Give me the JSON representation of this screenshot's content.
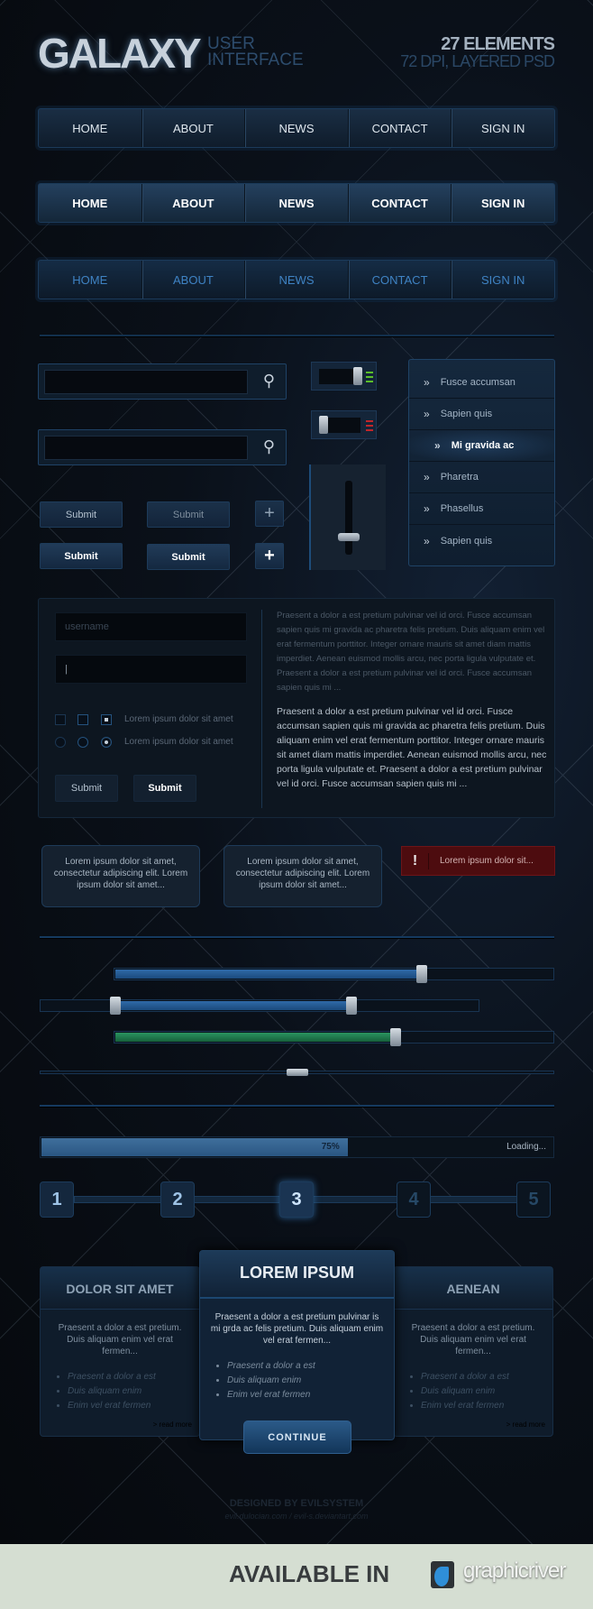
{
  "header": {
    "title": "GALAXY",
    "subtitle_line1": "USER",
    "subtitle_line2": "INTERFACE",
    "elements": "27 ELEMENTS",
    "info": "72 DPI, LAYERED PSD"
  },
  "nav": {
    "items": [
      "HOME",
      "ABOUT",
      "NEWS",
      "CONTACT",
      "SIGN IN"
    ]
  },
  "toggles": [
    {
      "state": "on",
      "led_color": "#5bbf2a"
    },
    {
      "state": "off",
      "led_color": "#c0262a"
    }
  ],
  "vertical_slider": {
    "value": 0.25
  },
  "menu": {
    "items": [
      "Fusce accumsan",
      "Sapien quis",
      "Mi gravida ac",
      "Pharetra",
      "Phasellus",
      "Sapien quis"
    ],
    "active_index": 2
  },
  "buttons": {
    "submit": "Submit",
    "plus": "+"
  },
  "form": {
    "username_placeholder": "username",
    "option_label": "Lorem ipsum dolor sit amet",
    "submit": "Submit",
    "text_light": "Praesent a dolor a est pretium pulvinar vel id orci. Fusce accumsan sapien quis mi gravida ac pharetra felis pretium. Duis aliquam enim vel erat fermentum porttitor. Integer ornare mauris sit amet diam mattis imperdiet. Aenean euismod mollis arcu, nec porta ligula vulputate et. Praesent a dolor a est pretium pulvinar vel id orci. Fusce accumsan sapien quis mi ...",
    "text_bold": "Praesent a dolor a est pretium pulvinar vel id orci. Fusce accumsan sapien quis mi gravida ac pharetra felis pretium. Duis aliquam enim vel erat fermentum porttitor. Integer ornare mauris sit amet diam mattis imperdiet. Aenean euismod mollis arcu, nec porta ligula vulputate et. Praesent a dolor a est pretium pulvinar vel id orci. Fusce accumsan sapien quis mi ..."
  },
  "tooltips": {
    "text": "Lorem ipsum dolor sit amet, consectetur adipiscing elit. Lorem ipsum dolor sit amet...",
    "error_icon": "!",
    "error": "Lorem ipsum dolor sit..."
  },
  "sliders": {
    "slider1": 0.7,
    "range_low": 0.17,
    "range_high": 0.71,
    "green": 0.64,
    "thin": 0.5,
    "colors": {
      "blue": "#2f6aa8",
      "green": "#1f7a4a"
    }
  },
  "progress": {
    "value": 75,
    "label": "75%",
    "status": "Loading..."
  },
  "pagination": {
    "pages": [
      "1",
      "2",
      "3",
      "4",
      "5"
    ],
    "active": "3"
  },
  "pricing": [
    {
      "title": "DOLOR SIT AMET",
      "text": "Praesent a dolor a est pretium. Duis aliquam enim vel erat fermen...",
      "items": [
        "Praesent a dolor a est",
        "Duis aliquam enim",
        "Enim vel erat fermen"
      ],
      "more": "> read more"
    },
    {
      "title": "LOREM IPSUM",
      "text": "Praesent a dolor a est pretium pulvinar is mi grda ac felis pretium. Duis aliquam enim vel erat fermen...",
      "items": [
        "Praesent a dolor a est",
        "Duis aliquam enim",
        "Enim vel erat fermen"
      ],
      "button": "CONTINUE"
    },
    {
      "title": "AENEAN",
      "text": "Praesent a dolor a est pretium. Duis aliquam enim vel erat fermen...",
      "items": [
        "Praesent a dolor a est",
        "Duis aliquam enim",
        "Enim vel erat fermen"
      ],
      "more": "> read more"
    }
  ],
  "footer": {
    "designed": "DESIGNED BY EVILSYSTEM",
    "links": "evil.dulocian.com  /  evil-s.deviantart.com",
    "available": "AVAILABLE IN",
    "brand": "graphicriver"
  }
}
